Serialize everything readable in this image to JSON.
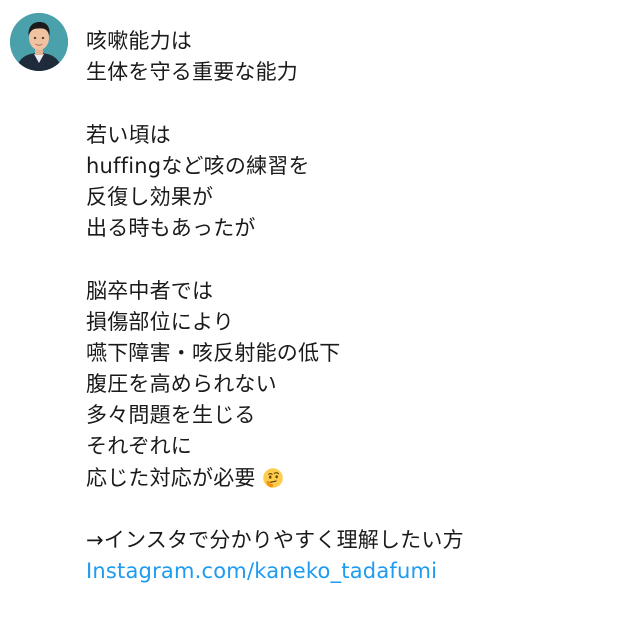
{
  "author": {
    "avatar_icon": "profile-photo-avatar"
  },
  "post": {
    "paragraph1": [
      "咳嗽能力は",
      "生体を守る重要な能力"
    ],
    "paragraph2": [
      "若い頃は",
      "huffingなど咳の練習を",
      "反復し効果が",
      "出る時もあったが"
    ],
    "paragraph3": [
      "脳卒中者では",
      "損傷部位により",
      "嚥下障害・咳反射能の低下",
      "腹圧を高められない",
      "多々問題を生じる",
      "それぞれに",
      "応じた対応が必要"
    ],
    "thinking_emoji": "thinking-face-icon",
    "cta_text": "→インスタで分かりやすく理解したい方",
    "link_text": "Instagram.com/kaneko_tadafumi"
  },
  "colors": {
    "link": "#1d9bf0",
    "text": "#1a1a1a",
    "background": "#ffffff",
    "emoji_face": "#ffcc4d"
  }
}
